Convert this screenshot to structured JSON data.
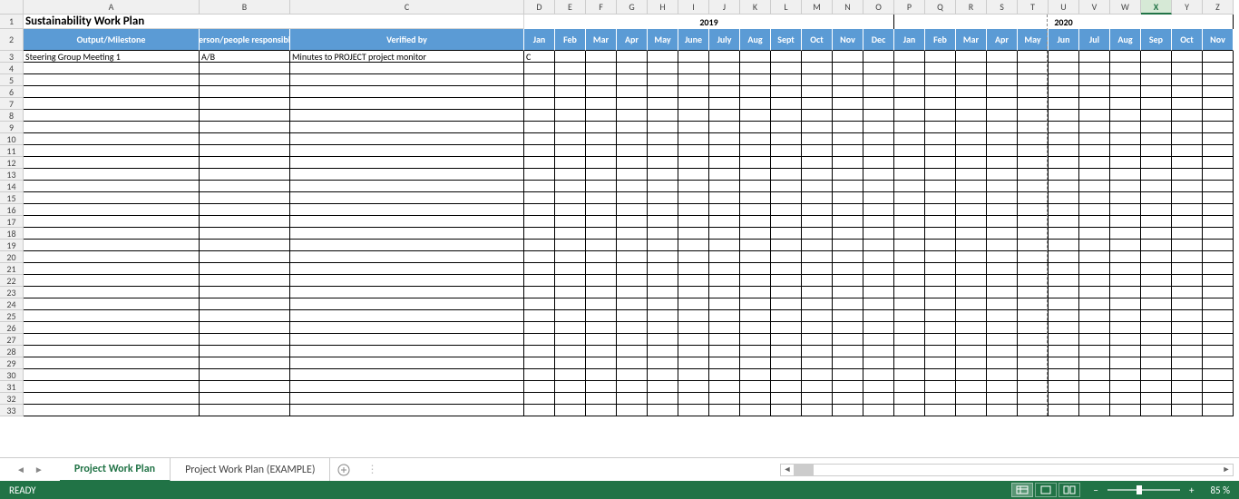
{
  "columns": [
    "A",
    "B",
    "C",
    "D",
    "E",
    "F",
    "G",
    "H",
    "I",
    "J",
    "K",
    "L",
    "M",
    "N",
    "O",
    "P",
    "Q",
    "R",
    "S",
    "T",
    "U",
    "V",
    "W",
    "X",
    "Y",
    "Z"
  ],
  "selected_column": "X",
  "title": "Sustainability Work Plan",
  "year1": "2019",
  "year2": "2020",
  "headers": {
    "output": "Output/Milestone",
    "person": "Person/people responsible",
    "verified": "Verified by"
  },
  "months": [
    "Jan",
    "Feb",
    "Mar",
    "Apr",
    "May",
    "June",
    "July",
    "Aug",
    "Sept",
    "Oct",
    "Nov",
    "Dec",
    "Jan",
    "Feb",
    "Mar",
    "Apr",
    "May",
    "Jun",
    "Jul",
    "Aug",
    "Sep",
    "Oct",
    "Nov"
  ],
  "data_row": {
    "output": "Steering Group Meeting 1",
    "person": "A/B",
    "verified": "Minutes to PROJECT project monitor",
    "d": "C"
  },
  "row_numbers_visible": 33,
  "tabs": {
    "active": "Project Work Plan",
    "other": "Project Work Plan (EXAMPLE)"
  },
  "status": {
    "ready": "READY",
    "zoom": "85 %"
  }
}
